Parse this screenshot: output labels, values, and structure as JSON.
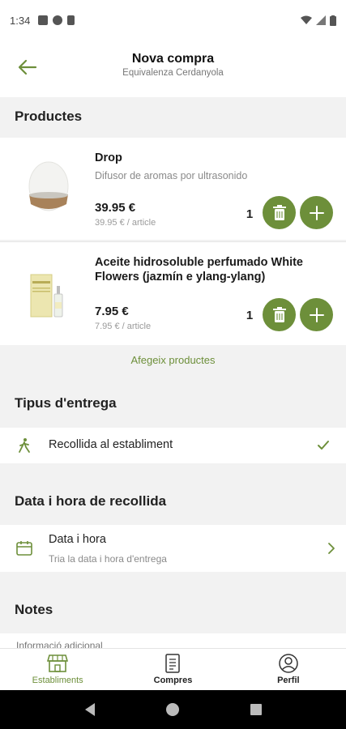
{
  "status_bar": {
    "time": "1:34"
  },
  "header": {
    "title": "Nova compra",
    "subtitle": "Equivalenza Cerdanyola"
  },
  "sections": {
    "products": "Productes",
    "delivery": "Tipus d'entrega",
    "pickup_datetime": "Data i hora de recollida",
    "notes": "Notes"
  },
  "products": [
    {
      "name": "Drop",
      "description": "Difusor de aromas por ultrasonido",
      "price": "39.95 €",
      "unit_price": "39.95 € / article",
      "quantity": "1"
    },
    {
      "name": "Aceite hidrosoluble perfumado White Flowers (jazmín e ylang-ylang)",
      "description": "",
      "price": "7.95 €",
      "unit_price": "7.95 € / article",
      "quantity": "1"
    }
  ],
  "add_products_label": "Afegeix productes",
  "delivery_option": {
    "label": "Recollida al establiment",
    "selected": true
  },
  "datetime": {
    "label": "Data i hora",
    "hint": "Tria la data i hora d'entrega"
  },
  "notes": {
    "placeholder": "Informació adicional"
  },
  "bottom_nav": [
    {
      "label": "Establiments",
      "icon": "store-icon",
      "active": true
    },
    {
      "label": "Compres",
      "icon": "receipt-icon",
      "active": false
    },
    {
      "label": "Perfil",
      "icon": "profile-icon",
      "active": false
    }
  ],
  "colors": {
    "accent": "#6d8f3a",
    "background": "#f2f2f2"
  }
}
